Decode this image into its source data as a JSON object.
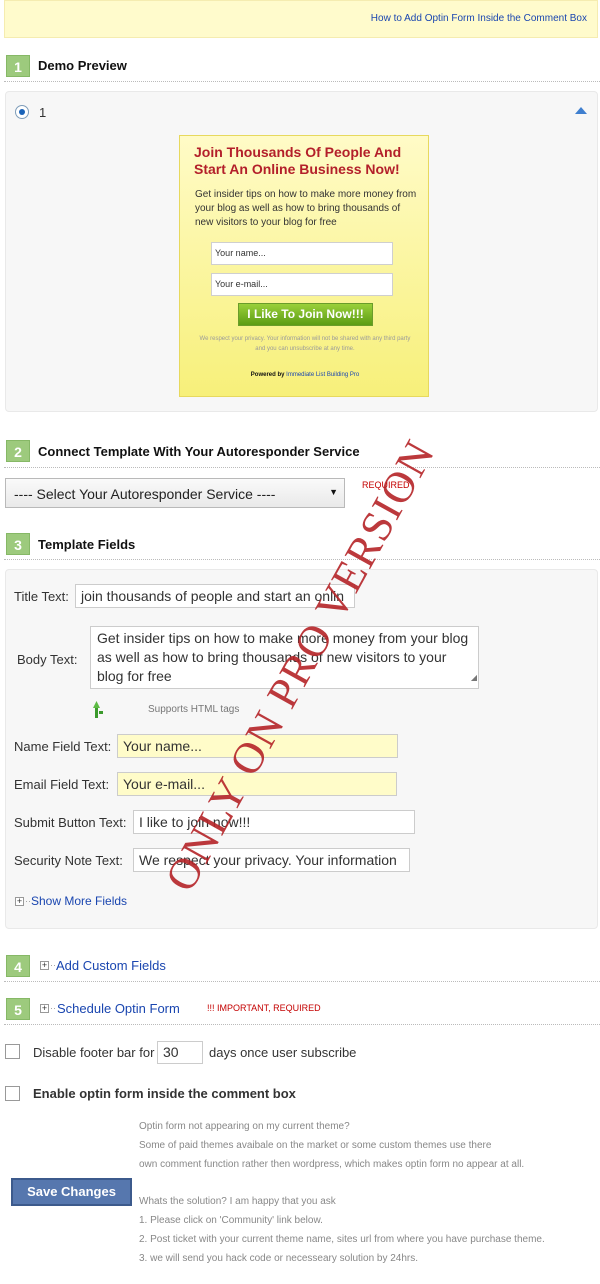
{
  "top_help_link": "How to Add Optin Form Inside the Comment Box",
  "steps": [
    {
      "num": "1",
      "title": "Demo Preview"
    },
    {
      "num": "2",
      "title": "Connect Template With Your Autoresponder Service"
    },
    {
      "num": "3",
      "title": "Template Fields"
    },
    {
      "num": "4",
      "title": "Add Custom Fields"
    },
    {
      "num": "5",
      "title": "Schedule Optin Form"
    }
  ],
  "preview": {
    "radio_label": "1",
    "optin": {
      "title": "Join Thousands Of People And Start An Online Business Now!",
      "body": "Get insider tips on how to make more money from your blog as well as how to bring thousands of new visitors to your blog for free",
      "name_placeholder": "Your name...",
      "email_placeholder": "Your e-mail...",
      "button": "I Like To Join Now!!!",
      "privacy": "We respect your privacy. Your information will not be shared with any third party and you can unsubscribe at any time.",
      "powered_prefix": "Powered by",
      "powered_link": "Immediate List Building Pro"
    }
  },
  "autoresponder": {
    "select_value": "---- Select Your Autoresponder Service ----",
    "required": "REQUIRED"
  },
  "fields": {
    "title_label": "Title Text:",
    "title_value": "join thousands of people and start an onlin",
    "body_label": "Body Text:",
    "body_value": "Get insider tips on how to make more money from your blog as well as how to bring thousands of new visitors to your blog for free",
    "supports_html": "Supports HTML tags",
    "name_label": "Name Field Text:",
    "name_value": "Your name...",
    "email_label": "Email Field Text:",
    "email_value": "Your e-mail...",
    "submit_label": "Submit Button Text:",
    "submit_value": "I like to join now!!!",
    "security_label": "Security Note Text:",
    "security_value": "We respect your privacy. Your information",
    "show_more": "Show More Fields"
  },
  "schedule_note": "!!! IMPORTANT, REQUIRED",
  "footer_bar": {
    "prefix": "Disable footer bar for",
    "days_value": "30",
    "suffix": "days once user subscribe"
  },
  "comment_box": {
    "label": "Enable optin form inside the comment box"
  },
  "help": {
    "lines_a": [
      "Optin form not appearing on my current theme?",
      "Some of paid themes avaibale on the market or some custom themes use there",
      "own comment function rather then wordpress, which makes optin form no appear at all."
    ],
    "lines_b": [
      "Whats the solution? I am happy that you ask",
      "1. Please click on 'Community' link below.",
      "2. Post ticket with your current theme name, sites url from where you have purchase theme.",
      "3. we will send you hack code or necesseary solution by 24hrs."
    ]
  },
  "save_button": "Save Changes",
  "watermark": "ONLY ON PRO VERSION",
  "colors": {
    "step_badge": "#9dca7d",
    "link": "#1a46b0",
    "required": "#c40000",
    "watermark": "#b52428"
  }
}
